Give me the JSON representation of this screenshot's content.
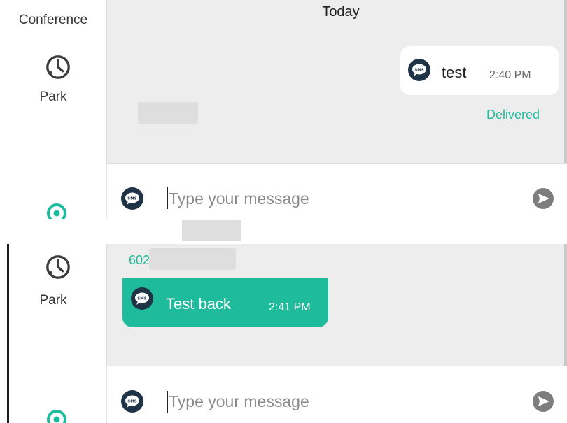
{
  "top_panel": {
    "sidebar": {
      "conference_label": "Conference",
      "park_label": "Park"
    },
    "chat": {
      "day_label": "Today",
      "outgoing_message": {
        "text": "test",
        "time": "2:40 PM",
        "status": "Delivered"
      }
    },
    "compose": {
      "placeholder": "Type your message"
    }
  },
  "bottom_panel": {
    "sidebar": {
      "park_label": "Park"
    },
    "chat": {
      "sender_prefix": "602",
      "incoming_message": {
        "text": "Test back",
        "time": "2:41 PM"
      }
    },
    "compose": {
      "placeholder": "Type your message"
    }
  },
  "colors": {
    "accent_green": "#1ebc9c",
    "chat_background": "#ededed",
    "sms_icon_navy": "#1f3347",
    "send_icon_gray": "#7d7d7d"
  },
  "icons": {
    "park": "clock-icon",
    "sms": "sms-icon",
    "send": "send-arrow-icon",
    "status_ring": "green-ring-icon"
  }
}
